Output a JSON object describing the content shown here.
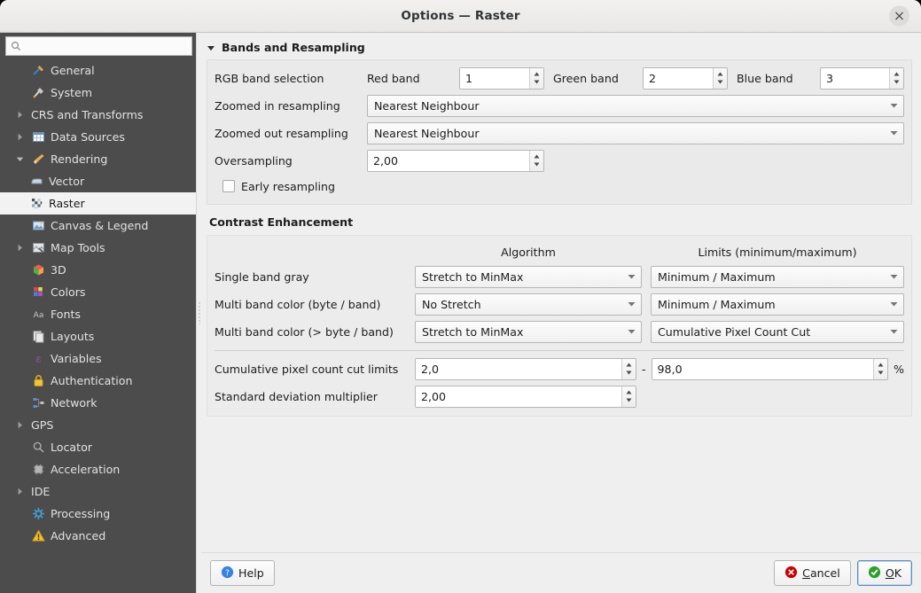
{
  "window": {
    "title": "Options — Raster",
    "close_label": "×"
  },
  "sidebar": {
    "search": {
      "value": "",
      "placeholder": "",
      "icon": "search-icon"
    },
    "items": [
      {
        "label": "General",
        "icon": "hammer-wrench-icon",
        "level": 0,
        "expandable": false,
        "expanded": false,
        "selected": false
      },
      {
        "label": "System",
        "icon": "system-tools-icon",
        "level": 0,
        "expandable": false,
        "expanded": false,
        "selected": false
      },
      {
        "label": "CRS and Transforms",
        "icon": "none",
        "level": 0,
        "expandable": true,
        "expanded": false,
        "selected": false
      },
      {
        "label": "Data Sources",
        "icon": "table-icon",
        "level": 0,
        "expandable": true,
        "expanded": false,
        "selected": false
      },
      {
        "label": "Rendering",
        "icon": "paintbrush-icon",
        "level": 0,
        "expandable": true,
        "expanded": true,
        "selected": false
      },
      {
        "label": "Vector",
        "icon": "polygon-icon",
        "level": 1,
        "expandable": false,
        "expanded": false,
        "selected": false
      },
      {
        "label": "Raster",
        "icon": "raster-grid-icon",
        "level": 1,
        "expandable": false,
        "expanded": false,
        "selected": true
      },
      {
        "label": "Canvas & Legend",
        "icon": "canvas-icon",
        "level": 0,
        "expandable": false,
        "expanded": false,
        "selected": false
      },
      {
        "label": "Map Tools",
        "icon": "map-tools-icon",
        "level": 0,
        "expandable": true,
        "expanded": false,
        "selected": false
      },
      {
        "label": "3D",
        "icon": "cube-icon",
        "level": 0,
        "expandable": false,
        "expanded": false,
        "selected": false
      },
      {
        "label": "Colors",
        "icon": "color-swatch-icon",
        "level": 0,
        "expandable": false,
        "expanded": false,
        "selected": false
      },
      {
        "label": "Fonts",
        "icon": "font-aa-icon",
        "level": 0,
        "expandable": false,
        "expanded": false,
        "selected": false
      },
      {
        "label": "Layouts",
        "icon": "layout-page-icon",
        "level": 0,
        "expandable": false,
        "expanded": false,
        "selected": false
      },
      {
        "label": "Variables",
        "icon": "epsilon-icon",
        "level": 0,
        "expandable": false,
        "expanded": false,
        "selected": false
      },
      {
        "label": "Authentication",
        "icon": "lock-icon",
        "level": 0,
        "expandable": false,
        "expanded": false,
        "selected": false
      },
      {
        "label": "Network",
        "icon": "network-icon",
        "level": 0,
        "expandable": false,
        "expanded": false,
        "selected": false
      },
      {
        "label": "GPS",
        "icon": "none",
        "level": 0,
        "expandable": true,
        "expanded": false,
        "selected": false
      },
      {
        "label": "Locator",
        "icon": "search-small-icon",
        "level": 0,
        "expandable": false,
        "expanded": false,
        "selected": false
      },
      {
        "label": "Acceleration",
        "icon": "chip-icon",
        "level": 0,
        "expandable": false,
        "expanded": false,
        "selected": false
      },
      {
        "label": "IDE",
        "icon": "none",
        "level": 0,
        "expandable": true,
        "expanded": false,
        "selected": false
      },
      {
        "label": "Processing",
        "icon": "gear-star-icon",
        "level": 0,
        "expandable": false,
        "expanded": false,
        "selected": false
      },
      {
        "label": "Advanced",
        "icon": "warning-icon",
        "level": 0,
        "expandable": false,
        "expanded": false,
        "selected": false
      }
    ]
  },
  "bands_section": {
    "title": "Bands and Resampling",
    "rgb_band_selection_label": "RGB band selection",
    "red_band_label": "Red band",
    "red_band_value": "1",
    "green_band_label": "Green band",
    "green_band_value": "2",
    "blue_band_label": "Blue band",
    "blue_band_value": "3",
    "zoomed_in_label": "Zoomed in resampling",
    "zoomed_in_value": "Nearest Neighbour",
    "zoomed_out_label": "Zoomed out resampling",
    "zoomed_out_value": "Nearest Neighbour",
    "oversampling_label": "Oversampling",
    "oversampling_value": "2,00",
    "early_resampling_label": "Early resampling",
    "early_resampling_checked": false
  },
  "contrast_section": {
    "title": "Contrast Enhancement",
    "col_algorithm": "Algorithm",
    "col_limits": "Limits (minimum/maximum)",
    "rows": [
      {
        "label": "Single band gray",
        "algorithm": "Stretch to MinMax",
        "limits": "Minimum / Maximum"
      },
      {
        "label": "Multi band color (byte / band)",
        "algorithm": "No Stretch",
        "limits": "Minimum / Maximum"
      },
      {
        "label": "Multi band color (> byte / band)",
        "algorithm": "Stretch to MinMax",
        "limits": "Cumulative Pixel Count Cut"
      }
    ],
    "cumulative_label": "Cumulative pixel count cut limits",
    "cumulative_min": "2,0",
    "cumulative_separator": "-",
    "cumulative_max": "98,0",
    "cumulative_unit": "%",
    "stddev_label": "Standard deviation multiplier",
    "stddev_value": "2,00"
  },
  "footer": {
    "help_label": "Help",
    "cancel_label": "Cancel",
    "ok_label": "OK"
  }
}
